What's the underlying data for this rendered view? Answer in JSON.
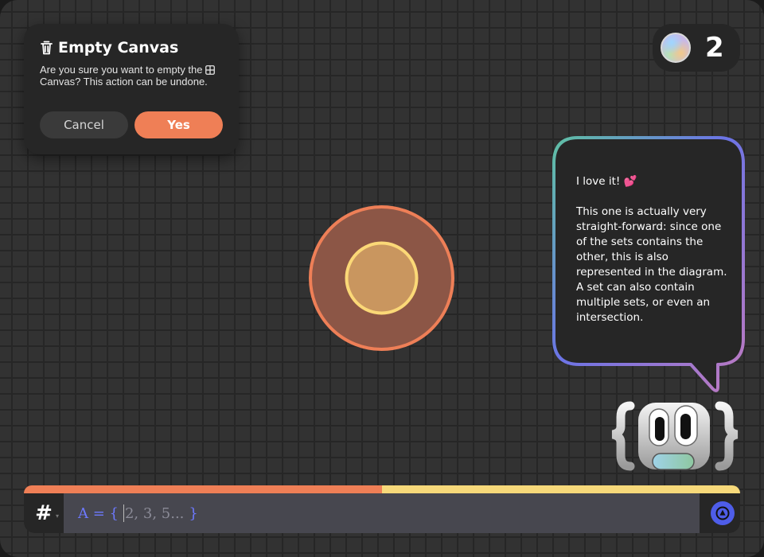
{
  "dialog": {
    "title": "Empty Canvas",
    "message_before": "Are you sure you want to empty the",
    "message_after": "Canvas? This action can be undone.",
    "cancel_label": "Cancel",
    "yes_label": "Yes",
    "icon": "trash-icon"
  },
  "score": {
    "value": "2",
    "icon": "orb-icon"
  },
  "bubble": {
    "line1": "I love it! 💕",
    "body": "This one is actually very straight-forward: since one of the sets contains the other, this is also represented in the diagram. A set can also contain multiple sets, or even an intersection."
  },
  "input": {
    "mode_symbol": "#",
    "prefix": "A = {",
    "placeholder": "2, 3, 5...",
    "suffix": "}"
  },
  "progress": {
    "fraction": 0.5
  },
  "colors": {
    "accent_orange": "#ef7f56",
    "accent_yellow": "#f7d97a",
    "accent_blue": "#4e5de9"
  }
}
